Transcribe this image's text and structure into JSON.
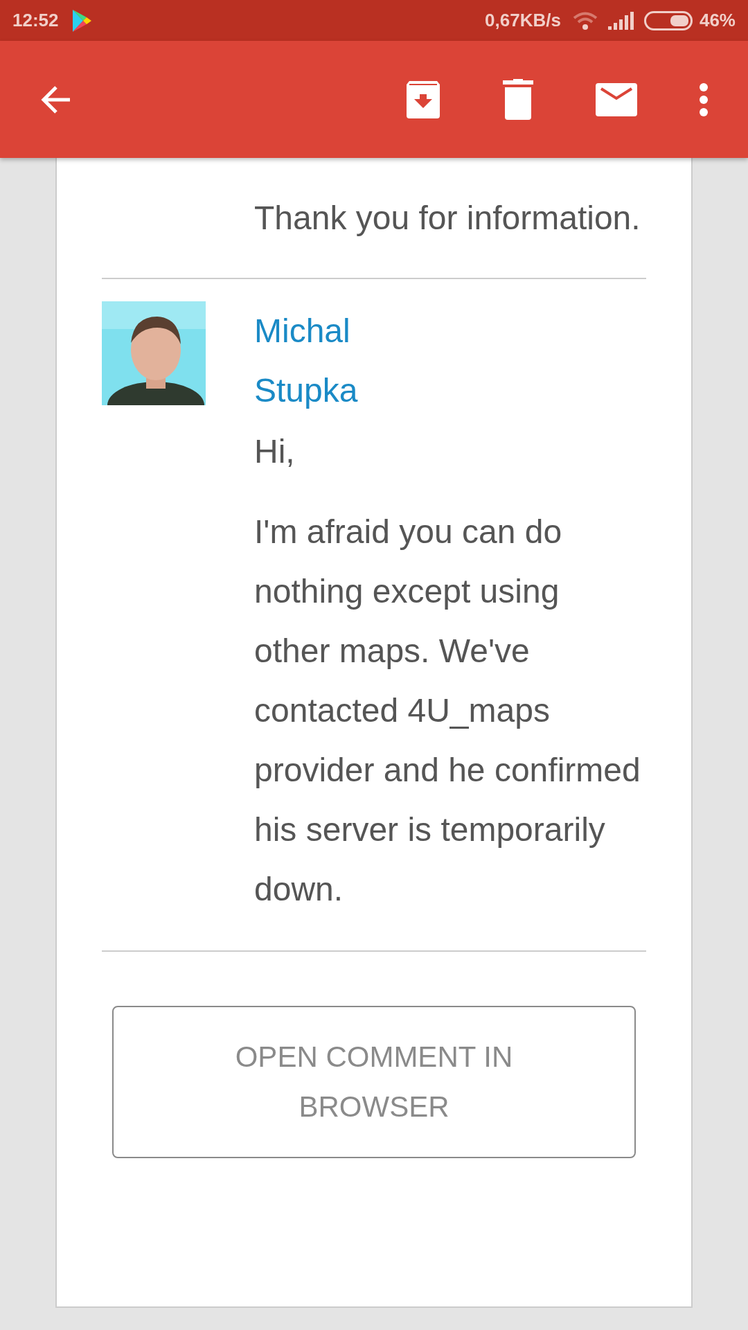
{
  "status_bar": {
    "time": "12:52",
    "speed": "0,67KB/s",
    "battery": "46%"
  },
  "comments": [
    {
      "paragraphs": [
        "Thank you for information."
      ]
    },
    {
      "author": "Michal Stupka",
      "paragraphs": [
        "Hi,",
        "I'm afraid you can do nothing except using other maps. We've contacted 4U_maps provider and he confirmed his server is temporarily down."
      ]
    }
  ],
  "open_button": "OPEN COMMENT IN BROWSER"
}
